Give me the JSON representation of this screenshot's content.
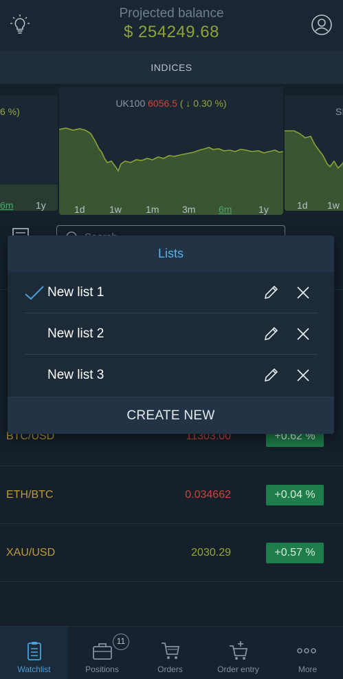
{
  "header": {
    "projected_label": "Projected balance",
    "projected_value": "$ 254249.68",
    "bulb_icon": "lightbulb-icon",
    "profile_icon": "user-profile-icon"
  },
  "indices_label": "INDICES",
  "carousel": {
    "left_card": {
      "title_fragment": "6 %)",
      "periods": [
        "6m",
        "1y"
      ],
      "active": "6m"
    },
    "center_card": {
      "symbol": "UK100",
      "price": "6056.5",
      "change": "( ↓ 0.30 %)",
      "periods": [
        "1d",
        "1w",
        "1m",
        "3m",
        "6m",
        "1y"
      ],
      "active": "6m"
    },
    "right_card": {
      "title_fragment": "SI",
      "periods": [
        "1d",
        "1w"
      ]
    }
  },
  "search": {
    "placeholder": "Search"
  },
  "rows": [
    {
      "symbol": "BTC/USD",
      "value": "11303.00",
      "value_color": "#c9453e",
      "change": "+0.62 %"
    },
    {
      "symbol": "ETH/BTC",
      "value": "0.034662",
      "value_color": "#c9453e",
      "change": "+0.04 %"
    },
    {
      "symbol": "XAU/USD",
      "value": "2030.29",
      "value_color": "#93a63c",
      "change": "+0.57 %"
    }
  ],
  "modal": {
    "title": "Lists",
    "items": [
      {
        "label": "New list 1",
        "selected": true
      },
      {
        "label": "New list 2",
        "selected": false
      },
      {
        "label": "New list 3",
        "selected": false
      }
    ],
    "create_label": "CREATE NEW"
  },
  "nav": {
    "tabs": [
      {
        "label": "Watchlist",
        "icon": "clipboard-icon",
        "active": true
      },
      {
        "label": "Positions",
        "icon": "briefcase-icon",
        "badge": "11"
      },
      {
        "label": "Orders",
        "icon": "cart-icon"
      },
      {
        "label": "Order entry",
        "icon": "cart-plus-icon"
      },
      {
        "label": "More",
        "icon": "more-dots-icon"
      }
    ]
  },
  "colors": {
    "accent_blue": "#4aa0d8",
    "positive_green": "#1e7d4b",
    "negative_red": "#c9453e",
    "symbol_gold": "#bd9a3c"
  }
}
